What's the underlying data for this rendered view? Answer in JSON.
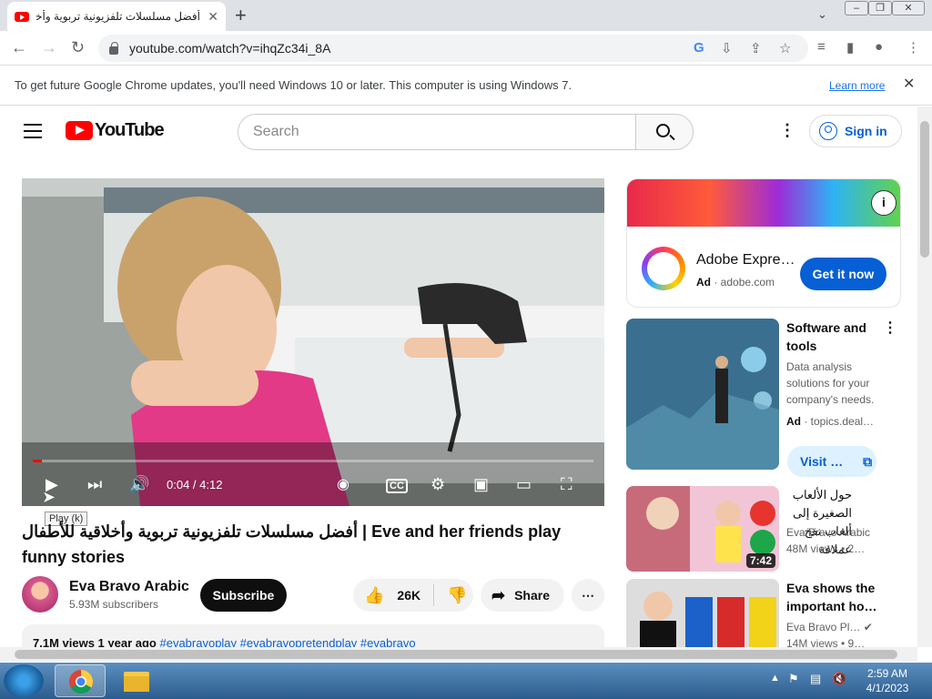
{
  "browser": {
    "tab_title": "أفضل مسلسلات تلفزيونية تربوية وأخلاقية ل",
    "tab_close": "✕",
    "new_tab": "+",
    "url": "youtube.com/watch?v=ihqZc34i_8A",
    "infobar_message": "To get future Google Chrome updates, you'll need Windows 10 or later. This computer is using Windows 7.",
    "infobar_link": "Learn more",
    "infobar_close": "✕"
  },
  "youtube": {
    "logo_text": "YouTube",
    "search_placeholder": "Search",
    "sign_in": "Sign in"
  },
  "player": {
    "time": "0:04 / 4:12",
    "progress_fraction": 0.016,
    "tooltip": "Play (k)",
    "cc_label": "CC"
  },
  "video": {
    "title": "أفضل مسلسلات تلفزيونية تربوية وأخلاقية للأطفال | Eve and her friends play funny stories",
    "channel": "Eva Bravo Arabic",
    "subscribers": "5.93M subscribers",
    "subscribe_label": "Subscribe",
    "likes": "26K",
    "share_label": "Share",
    "desc_stats": "7.1M views  1 year ago",
    "desc_tags": "#evabravoplay #evabravopretendplay #evabravo"
  },
  "ad": {
    "name": "Adobe Expre…",
    "ad_label": "Ad",
    "domain": "adobe.com",
    "cta": "Get it now"
  },
  "recommendations": [
    {
      "title": "Software and tools",
      "meta1": "Data analysis solutions for your company's needs.",
      "ad_label": "Ad",
      "meta2": "topics.deal…",
      "visit": "Visit …"
    },
    {
      "title": "حول الألعاب الصغيرة إلى ألعاب نفخ عملاقة",
      "channel": "Eva Bravo Arabic",
      "meta": "48M views  •  2…",
      "duration": "7:42"
    },
    {
      "title": "Eva shows the important ho…",
      "channel": "Eva Bravo Pl…",
      "meta": "14M views  •  9…"
    }
  ],
  "taskbar": {
    "time": "2:59 AM",
    "date": "4/1/2023"
  }
}
